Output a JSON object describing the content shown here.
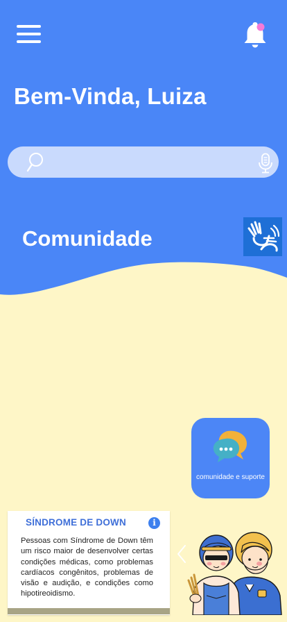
{
  "header": {
    "greeting": "Bem-Vinda, Luiza",
    "menu_icon": "hamburger-menu-icon",
    "notification_icon": "bell-icon"
  },
  "search": {
    "value": "",
    "placeholder": "",
    "search_icon": "magnifier-icon",
    "voice_icon": "microphone-icon"
  },
  "section": {
    "title": "Comunidade",
    "accessibility_icon": "sign-language-icon"
  },
  "feature_card": {
    "label": "comunidade e suporte",
    "icon": "chat-bubbles-icon"
  },
  "info_card": {
    "title": "SÍNDROME DE DOWN",
    "icon": "info-icon",
    "icon_glyph": "i",
    "text": "Pessoas com Síndrome de Down têm um risco maior de desenvolver certas condições médicas, como problemas cardíacos congênitos, problemas de visão e audição, e condições como hipotireoidismo."
  },
  "carousel": {
    "prev_icon": "chevron-left-icon",
    "illustration": "two-children-illustration"
  },
  "colors": {
    "header_blue": "#4a86f7",
    "background_cream": "#fef6c7",
    "search_bg": "#c9dafd",
    "card_blue": "#4c86f6",
    "notification_dot": "#f57ad8",
    "title_blue": "#3f6fd8"
  }
}
